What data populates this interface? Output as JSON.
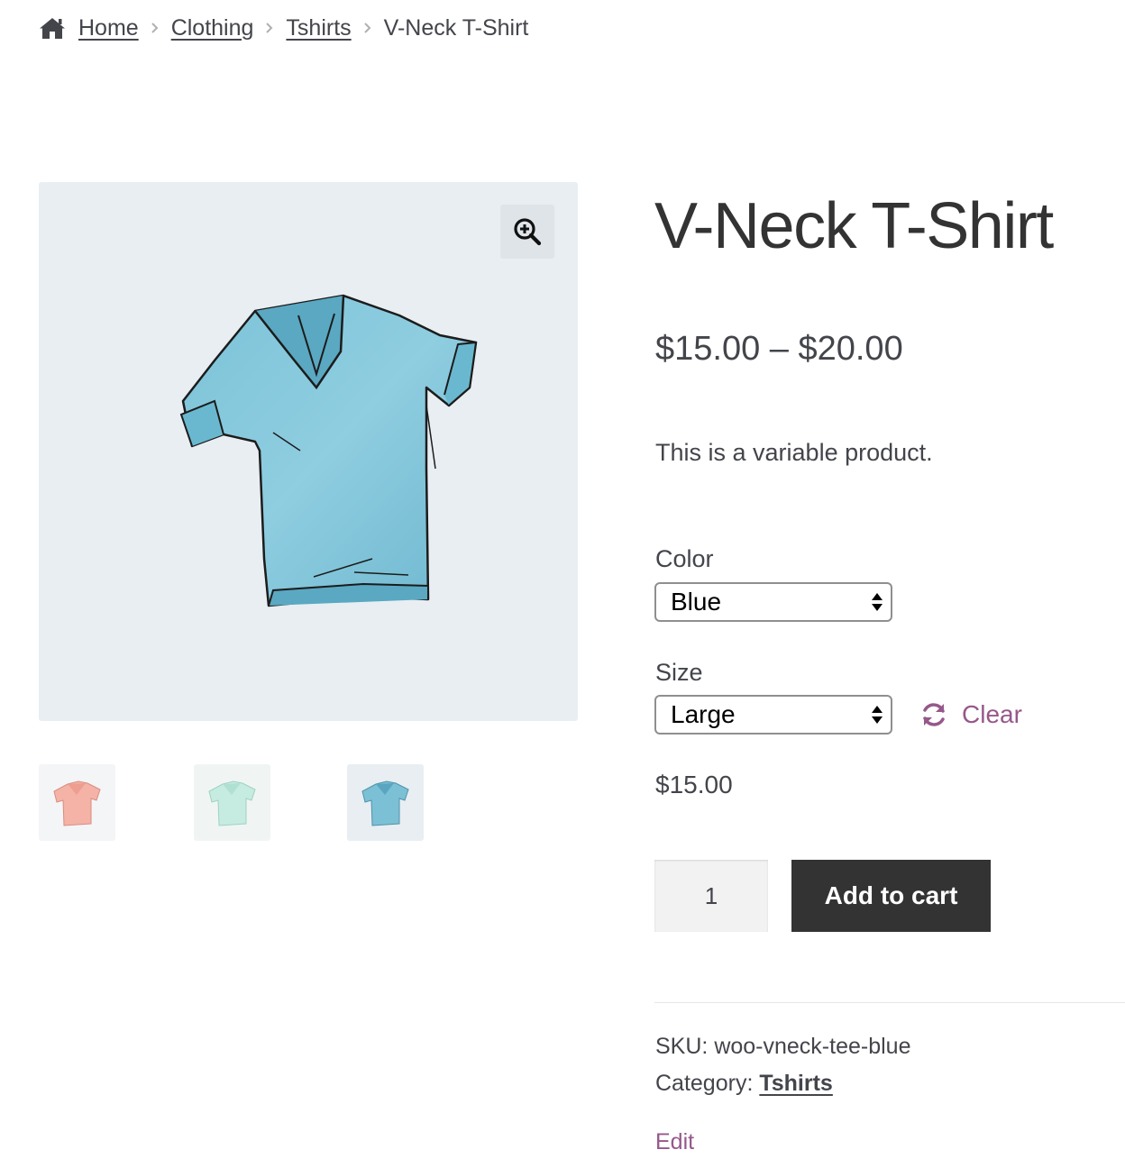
{
  "breadcrumb": {
    "home_icon": "home-icon",
    "items": [
      "Home",
      "Clothing",
      "Tshirts"
    ],
    "current": "V-Neck T-Shirt"
  },
  "gallery": {
    "zoom_icon": "magnifier-plus-icon",
    "main_image_color": "blue",
    "thumbnails": [
      "pink",
      "mint",
      "blue"
    ]
  },
  "product": {
    "title": "V-Neck T-Shirt",
    "price_range": "$15.00 – $20.00",
    "description": "This is a variable product.",
    "variations": {
      "color_label": "Color",
      "color_value": "Blue",
      "size_label": "Size",
      "size_value": "Large",
      "clear_label": "Clear"
    },
    "variation_price": "$15.00",
    "quantity": "1",
    "add_to_cart_label": "Add to cart",
    "meta": {
      "sku_label": "SKU:",
      "sku_value": "woo-vneck-tee-blue",
      "category_label": "Category:",
      "category_value": "Tshirts"
    },
    "edit_label": "Edit"
  },
  "colors": {
    "accent": "#96588a",
    "button_bg": "#333333",
    "text": "#43454b",
    "image_bg": "#e8eef2"
  }
}
